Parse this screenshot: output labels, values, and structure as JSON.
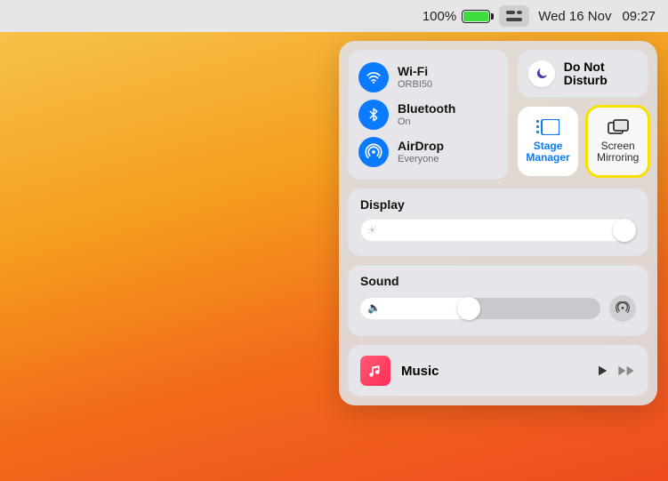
{
  "menubar": {
    "battery_pct": "100%",
    "date": "Wed 16 Nov",
    "time": "09:27"
  },
  "control_center": {
    "connectivity": {
      "wifi": {
        "title": "Wi-Fi",
        "sub": "ORBI50"
      },
      "bluetooth": {
        "title": "Bluetooth",
        "sub": "On"
      },
      "airdrop": {
        "title": "AirDrop",
        "sub": "Everyone"
      }
    },
    "dnd": {
      "line1": "Do Not",
      "line2": "Disturb"
    },
    "tiles": {
      "stage": {
        "line1": "Stage",
        "line2": "Manager"
      },
      "mirror": {
        "line1": "Screen",
        "line2": "Mirroring"
      }
    },
    "display": {
      "title": "Display",
      "value_pct": 100
    },
    "sound": {
      "title": "Sound",
      "value_pct": 45
    },
    "music": {
      "title": "Music"
    }
  }
}
